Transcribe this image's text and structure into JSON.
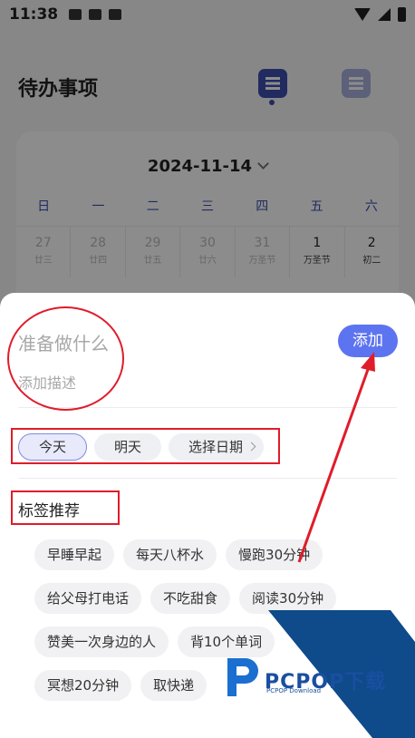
{
  "status_bar": {
    "time": "11:38"
  },
  "header": {
    "title": "待办事项"
  },
  "calendar": {
    "date": "2024-11-14",
    "weekdays": [
      "日",
      "一",
      "二",
      "三",
      "四",
      "五",
      "六"
    ],
    "row1": [
      {
        "num": "27",
        "sub": "廿三"
      },
      {
        "num": "28",
        "sub": "廿四"
      },
      {
        "num": "29",
        "sub": "廿五"
      },
      {
        "num": "30",
        "sub": "廿六"
      },
      {
        "num": "31",
        "sub": "万圣节"
      },
      {
        "num": "1",
        "sub": "万圣节"
      },
      {
        "num": "2",
        "sub": "初二"
      }
    ]
  },
  "sheet": {
    "task_placeholder": "准备做什么",
    "desc_placeholder": "添加描述",
    "add_label": "添加",
    "date_options": [
      "今天",
      "明天",
      "选择日期"
    ],
    "tags_title": "标签推荐",
    "tags": [
      "早睡早起",
      "每天八杯水",
      "慢跑30分钟",
      "给父母打电话",
      "不吃甜食",
      "阅读30分钟",
      "赞美一次身边的人",
      "背10个单词",
      "冥想20分钟",
      "取快递"
    ]
  },
  "watermark": {
    "brand": "PCPOP下载",
    "sub": "PCPOP Download"
  },
  "colors": {
    "accent": "#5d74f0",
    "nav_active": "#3d4fb0",
    "annotation": "#e01c2a",
    "watermark": "#0f4a8a"
  }
}
